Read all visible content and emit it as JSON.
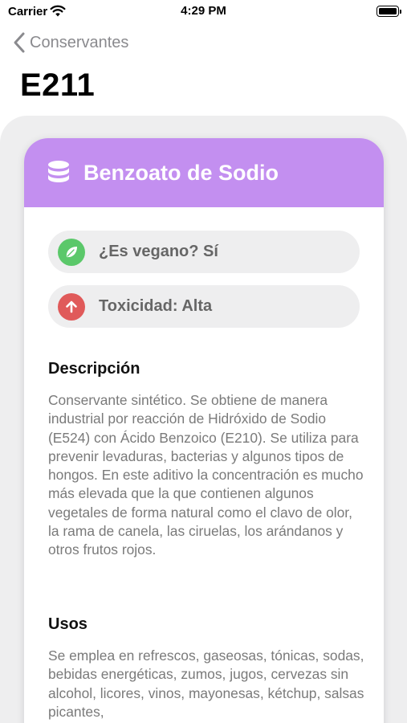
{
  "status_bar": {
    "carrier": "Carrier",
    "time": "4:29 PM"
  },
  "nav": {
    "back_label": "Conservantes",
    "title": "E211"
  },
  "card": {
    "header_color": "#c38ff0",
    "header_icon": "database-icon",
    "name": "Benzoato de Sodio",
    "badges": {
      "vegan": {
        "label": "¿Es vegano? Sí",
        "icon": "leaf-icon",
        "color": "#5bc86a"
      },
      "toxicity": {
        "label": "Toxicidad: Alta",
        "icon": "arrow-up-icon",
        "color": "#e05a5a"
      }
    },
    "description": {
      "title": "Descripción",
      "text": "Conservante sintético. Se obtiene de manera industrial por reacción de Hidróxido de Sodio (E524) con Ácido Benzoico (E210). Se utiliza para prevenir levaduras, bacterias y algunos tipos de hongos. En este aditivo la concentración es mucho más elevada que la que contienen algunos vegetales de forma natural como el clavo de olor, la rama de canela, las ciruelas, los arándanos y otros frutos rojos."
    },
    "uses": {
      "title": "Usos",
      "text": "Se emplea en refrescos, gaseosas, tónicas, sodas, bebidas energéticas, zumos, jugos, cervezas sin alcohol, licores, vinos, mayonesas, kétchup, salsas picantes,"
    }
  }
}
